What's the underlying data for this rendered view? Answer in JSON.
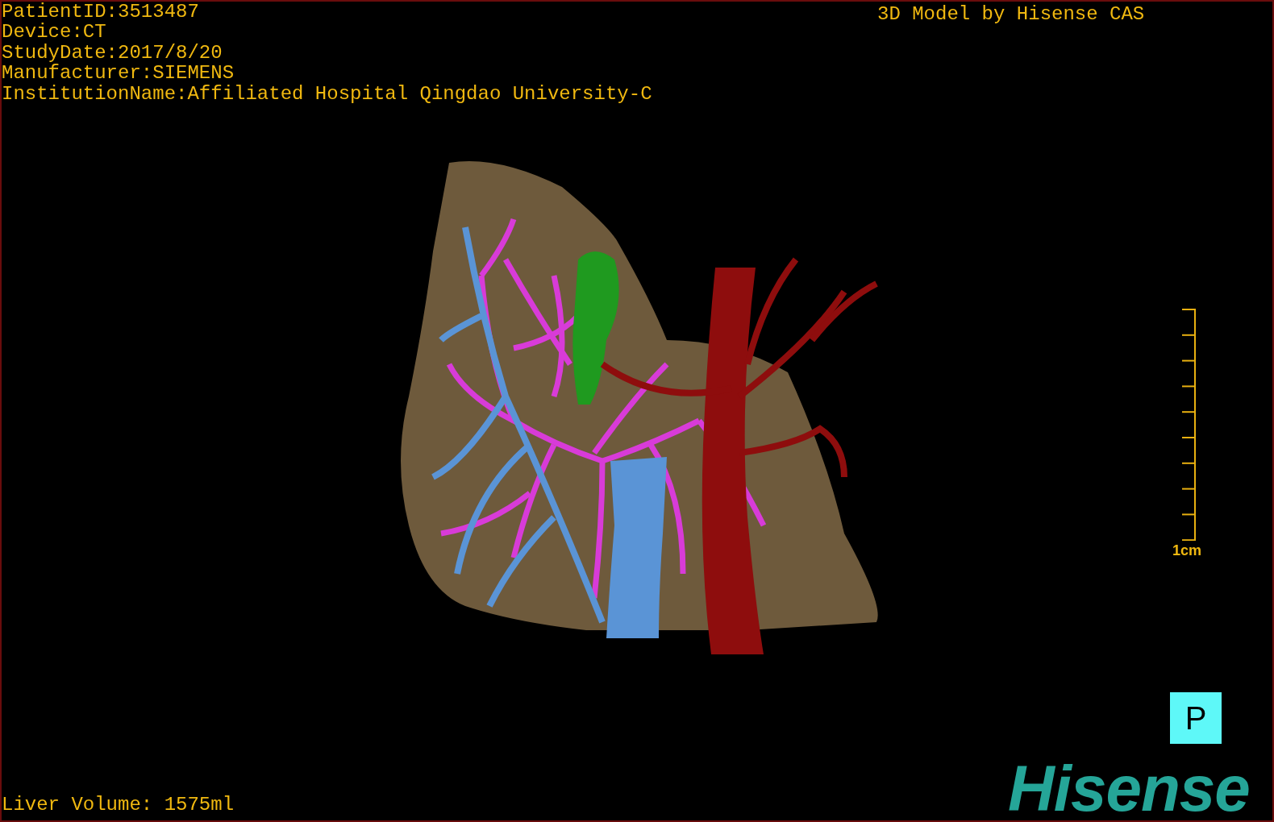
{
  "study_info": [
    "PatientID:3513487",
    "Device:CT",
    "StudyDate:2017/8/20",
    "Manufacturer:SIEMENS",
    "InstitutionName:Affiliated Hospital Qingdao University-C"
  ],
  "model_caption": "3D Model by Hisense CAS",
  "scale_bar": {
    "label": "1cm"
  },
  "orientation_marker": {
    "label": "P"
  },
  "liver_volume": "Liver Volume: 1575ml",
  "logo": "Hisense"
}
